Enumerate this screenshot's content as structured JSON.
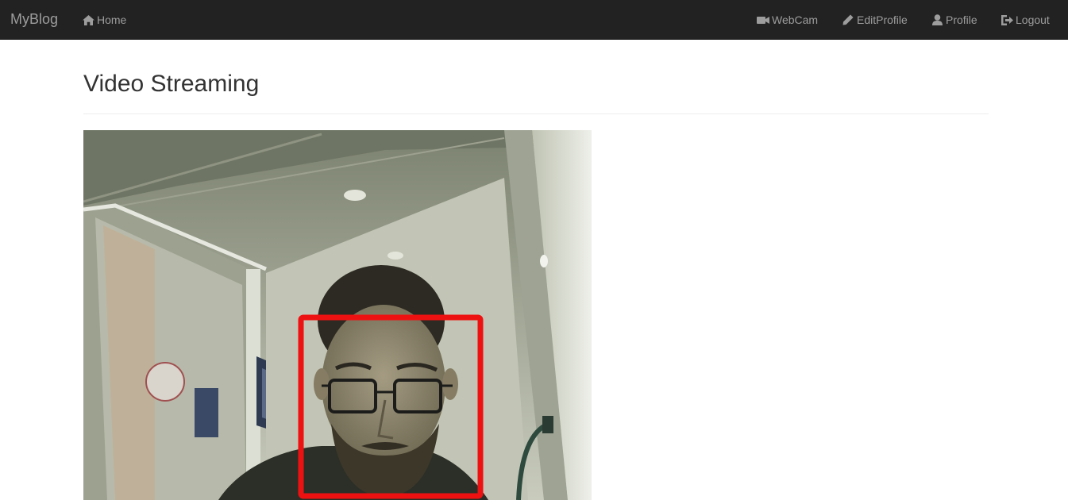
{
  "navbar": {
    "brand": "MyBlog",
    "left_items": [
      {
        "label": "Home",
        "icon": "home-icon"
      }
    ],
    "right_items": [
      {
        "label": "WebCam",
        "icon": "video-camera-icon"
      },
      {
        "label": "EditProfile",
        "icon": "pencil-icon"
      },
      {
        "label": "Profile",
        "icon": "user-icon"
      },
      {
        "label": "Logout",
        "icon": "logout-icon"
      }
    ],
    "colors": {
      "background": "#222222",
      "text": "#9d9d9d"
    }
  },
  "main": {
    "title": "Video Streaming",
    "video": {
      "description_label": "webcam-stream",
      "detection_box_color": "#ee1111"
    }
  }
}
